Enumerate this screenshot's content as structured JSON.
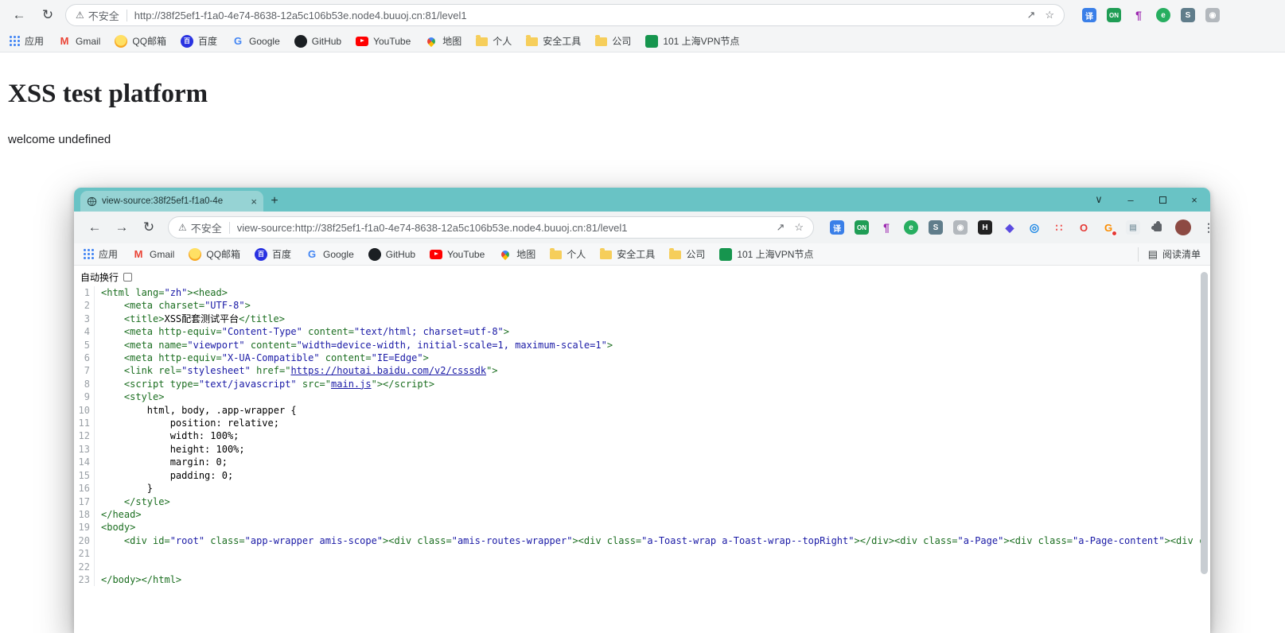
{
  "main_window": {
    "toolbar": {
      "security_label": "不安全",
      "url": "http://38f25ef1-f1a0-4e74-8638-12a5c106b53e.node4.buuoj.cn:81/level1"
    },
    "extensions": [
      {
        "name": "translate",
        "label": "译",
        "bg": "#3a7fe8",
        "fg": "#ffffff"
      },
      {
        "name": "proxy-on",
        "label": "ON",
        "bg": "#1f9d55",
        "fg": "#ffffff",
        "fs": 8
      },
      {
        "name": "pilcrow-tool",
        "label": "¶",
        "fg": "#9c27b0",
        "fs": 14
      },
      {
        "name": "evernote-clipper",
        "label": "e",
        "bg": "#27ae60",
        "fg": "#ffffff",
        "cls": "circle"
      },
      {
        "name": "s-tool",
        "label": "S",
        "bg": "#607d8b",
        "fg": "#ffffff"
      },
      {
        "name": "screenshot-tool",
        "label": "◉",
        "bg": "#b3b8bd",
        "fg": "#ffffff"
      }
    ],
    "page": {
      "title": "XSS test platform",
      "welcome": "welcome undefined"
    }
  },
  "bookmarks": [
    {
      "name": "apps",
      "label": "应用",
      "icon": "apps"
    },
    {
      "name": "gmail",
      "label": "Gmail",
      "icon": "gmail",
      "glyph": "M"
    },
    {
      "name": "qqmail",
      "label": "QQ邮箱",
      "icon": "qqmail"
    },
    {
      "name": "baidu",
      "label": "百度",
      "icon": "baidu",
      "glyph": "百"
    },
    {
      "name": "google",
      "label": "Google",
      "icon": "google",
      "glyph": "G"
    },
    {
      "name": "github",
      "label": "GitHub",
      "icon": "github"
    },
    {
      "name": "youtube",
      "label": "YouTube",
      "icon": "youtube"
    },
    {
      "name": "maps",
      "label": "地图",
      "icon": "maps"
    },
    {
      "name": "personal-folder",
      "label": "个人",
      "icon": "folder"
    },
    {
      "name": "security-tools-folder",
      "label": "安全工具",
      "icon": "folder"
    },
    {
      "name": "company-folder",
      "label": "公司",
      "icon": "folder"
    },
    {
      "name": "shanghai-vpn-node",
      "label": "101 上海VPN节点",
      "icon": "vpn"
    }
  ],
  "popup": {
    "tab": {
      "title": "view-source:38f25ef1-f1a0-4e"
    },
    "toolbar": {
      "security_label": "不安全",
      "url": "view-source:http://38f25ef1-f1a0-4e74-8638-12a5c106b53e.node4.buuoj.cn:81/level1"
    },
    "extensions": [
      {
        "name": "translate",
        "label": "译",
        "bg": "#3a7fe8",
        "fg": "#ffffff"
      },
      {
        "name": "proxy-on",
        "label": "ON",
        "bg": "#1f9d55",
        "fg": "#ffffff",
        "fs": 8
      },
      {
        "name": "pilcrow-tool",
        "label": "¶",
        "fg": "#9c27b0",
        "fs": 14
      },
      {
        "name": "evernote-clipper",
        "label": "e",
        "bg": "#27ae60",
        "fg": "#ffffff",
        "cls": "circle"
      },
      {
        "name": "s-tool",
        "label": "S",
        "bg": "#607d8b",
        "fg": "#ffffff"
      },
      {
        "name": "screenshot-tool",
        "label": "◉",
        "bg": "#b3b8bd",
        "fg": "#ffffff"
      },
      {
        "name": "h-tool",
        "label": "H",
        "bg": "#222222",
        "fg": "#ffffff"
      },
      {
        "name": "diamond-tool",
        "label": "◆",
        "fg": "#5b4be0",
        "fs": 14
      },
      {
        "name": "ring-tool",
        "label": "◎",
        "fg": "#1e88e5",
        "fs": 14
      },
      {
        "name": "grid-tool",
        "label": "∷",
        "fg": "#ef5350",
        "fs": 14
      },
      {
        "name": "opera-tool",
        "label": "O",
        "fg": "#e53935",
        "fs": 13
      },
      {
        "name": "g-tool",
        "label": "G",
        "fg": "#fb8c00",
        "fs": 13,
        "badge": true
      },
      {
        "name": "notebook-tool",
        "label": "▤",
        "bg": "#eceff1",
        "fg": "#90a4ae"
      },
      {
        "name": "extensions-puzzle",
        "cls": "puzzle"
      },
      {
        "name": "profile-avatar",
        "cls": "avatar"
      },
      {
        "name": "browser-menu",
        "label": "⋮",
        "fg": "#5f6368",
        "fs": 14
      }
    ],
    "reading_list_label": "阅读清单",
    "wrap_label": "自动换行",
    "source_lines": [
      {
        "n": 1,
        "i": 0,
        "t": [
          [
            "g",
            "<html lang="
          ],
          [
            "v",
            "\"zh\""
          ],
          [
            "g",
            "><head>"
          ]
        ]
      },
      {
        "n": 2,
        "i": 4,
        "t": [
          [
            "g",
            "<meta charset="
          ],
          [
            "v",
            "\"UTF-8\""
          ],
          [
            "g",
            ">"
          ]
        ]
      },
      {
        "n": 3,
        "i": 4,
        "t": [
          [
            "g",
            "<title>"
          ],
          [
            "p",
            "XSS配套测试平台"
          ],
          [
            "g",
            "</title>"
          ]
        ]
      },
      {
        "n": 4,
        "i": 4,
        "t": [
          [
            "g",
            "<meta http-equiv="
          ],
          [
            "v",
            "\"Content-Type\""
          ],
          [
            "g",
            " content="
          ],
          [
            "v",
            "\"text/html; charset=utf-8\""
          ],
          [
            "g",
            ">"
          ]
        ]
      },
      {
        "n": 5,
        "i": 4,
        "t": [
          [
            "g",
            "<meta name="
          ],
          [
            "v",
            "\"viewport\""
          ],
          [
            "g",
            " content="
          ],
          [
            "v",
            "\"width=device-width, initial-scale=1, maximum-scale=1\""
          ],
          [
            "g",
            ">"
          ]
        ]
      },
      {
        "n": 6,
        "i": 4,
        "t": [
          [
            "g",
            "<meta http-equiv="
          ],
          [
            "v",
            "\"X-UA-Compatible\""
          ],
          [
            "g",
            " content="
          ],
          [
            "v",
            "\"IE=Edge\""
          ],
          [
            "g",
            ">"
          ]
        ]
      },
      {
        "n": 7,
        "i": 4,
        "t": [
          [
            "g",
            "<link rel="
          ],
          [
            "v",
            "\"stylesheet\""
          ],
          [
            "g",
            " href=\""
          ],
          [
            "l",
            "https://houtai.baidu.com/v2/csssdk"
          ],
          [
            "g",
            "\">"
          ]
        ]
      },
      {
        "n": 8,
        "i": 4,
        "t": [
          [
            "g",
            "<script type="
          ],
          [
            "v",
            "\"text/javascript\""
          ],
          [
            "g",
            " src=\""
          ],
          [
            "l",
            "main.js"
          ],
          [
            "g",
            "\"></script>"
          ]
        ]
      },
      {
        "n": 9,
        "i": 4,
        "t": [
          [
            "g",
            "<style>"
          ]
        ]
      },
      {
        "n": 10,
        "i": 8,
        "t": [
          [
            "p",
            "html, body, .app-wrapper {"
          ]
        ]
      },
      {
        "n": 11,
        "i": 12,
        "t": [
          [
            "p",
            "position: relative;"
          ]
        ]
      },
      {
        "n": 12,
        "i": 12,
        "t": [
          [
            "p",
            "width: 100%;"
          ]
        ]
      },
      {
        "n": 13,
        "i": 12,
        "t": [
          [
            "p",
            "height: 100%;"
          ]
        ]
      },
      {
        "n": 14,
        "i": 12,
        "t": [
          [
            "p",
            "margin: 0;"
          ]
        ]
      },
      {
        "n": 15,
        "i": 12,
        "t": [
          [
            "p",
            "padding: 0;"
          ]
        ]
      },
      {
        "n": 16,
        "i": 8,
        "t": [
          [
            "p",
            "}"
          ]
        ]
      },
      {
        "n": 17,
        "i": 4,
        "t": [
          [
            "g",
            "</style>"
          ]
        ]
      },
      {
        "n": 18,
        "i": 0,
        "t": [
          [
            "g",
            "</head>"
          ]
        ]
      },
      {
        "n": 19,
        "i": 0,
        "t": [
          [
            "g",
            "<body>"
          ]
        ]
      },
      {
        "n": 20,
        "i": 4,
        "t": [
          [
            "g",
            "<div id="
          ],
          [
            "v",
            "\"root\""
          ],
          [
            "g",
            " class="
          ],
          [
            "v",
            "\"app-wrapper amis-scope\""
          ],
          [
            "g",
            "><div class="
          ],
          [
            "v",
            "\"amis-routes-wrapper\""
          ],
          [
            "g",
            "><div class="
          ],
          [
            "v",
            "\"a-Toast-wrap a-Toast-wrap--topRight\""
          ],
          [
            "g",
            "></div><div class="
          ],
          [
            "v",
            "\"a-Page\""
          ],
          [
            "g",
            "><div class="
          ],
          [
            "v",
            "\"a-Page-content\""
          ],
          [
            "g",
            "><div c"
          ]
        ]
      },
      {
        "n": 21,
        "i": 0,
        "t": []
      },
      {
        "n": 22,
        "i": 0,
        "t": []
      },
      {
        "n": 23,
        "i": 0,
        "t": [
          [
            "g",
            "</body></html>"
          ]
        ]
      }
    ]
  },
  "colors": {
    "titlebar_teal": "#69c3c5",
    "tab_teal": "#96d3d4",
    "toolbar_gray": "#f1f3f4",
    "tag_green": "#1b6e20",
    "value_blue": "#1a1aa6",
    "link_blue": "#1a1aa6",
    "line_number_gray": "#9aa0a6"
  }
}
